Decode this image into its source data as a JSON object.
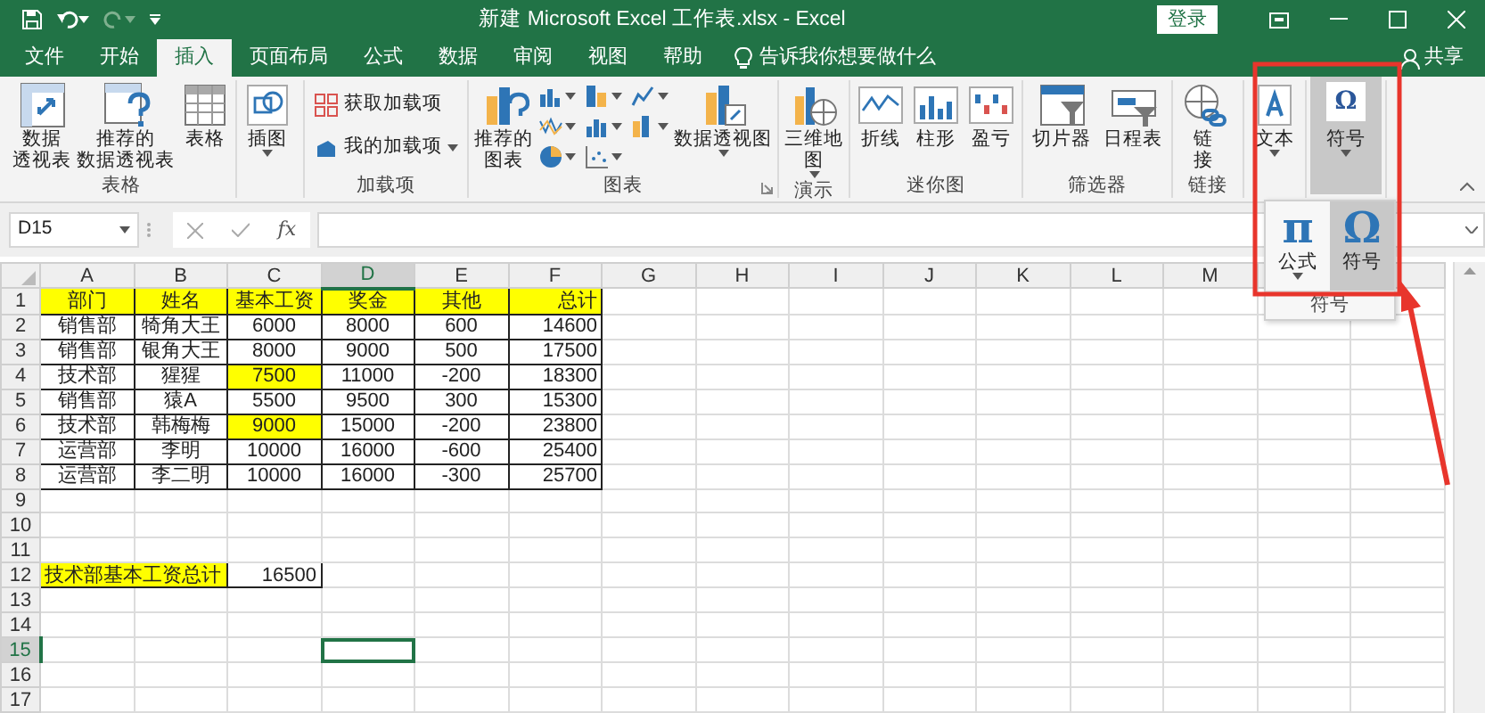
{
  "title_bar": {
    "title": "新建 Microsoft Excel 工作表.xlsx - Excel",
    "login": "登录"
  },
  "tabs": [
    {
      "label": "文件",
      "selected": false
    },
    {
      "label": "开始",
      "selected": false
    },
    {
      "label": "插入",
      "selected": true
    },
    {
      "label": "页面布局",
      "selected": false
    },
    {
      "label": "公式",
      "selected": false
    },
    {
      "label": "数据",
      "selected": false
    },
    {
      "label": "审阅",
      "selected": false
    },
    {
      "label": "视图",
      "selected": false
    },
    {
      "label": "帮助",
      "selected": false
    }
  ],
  "tell_me": "告诉我你想要做什么",
  "share": "共享",
  "ribbon": {
    "groups": [
      {
        "label": "表格",
        "buttons": [
          {
            "lines": [
              "数据",
              "透视表"
            ],
            "kind": "large",
            "dropdown": false
          },
          {
            "lines": [
              "推荐的",
              "数据透视表"
            ],
            "kind": "large",
            "dropdown": false
          },
          {
            "lines": [
              "表格"
            ],
            "kind": "large",
            "dropdown": false
          }
        ]
      },
      {
        "buttons": [
          {
            "lines": [
              "插图"
            ],
            "kind": "large",
            "dropdown": true
          }
        ]
      },
      {
        "label": "加载项",
        "buttons": [
          {
            "label": "获取加载项",
            "kind": "small",
            "dropdown": false
          },
          {
            "label": "我的加载项",
            "kind": "small",
            "dropdown": true
          }
        ]
      },
      {
        "label": "图表",
        "launcher": true,
        "buttons": [
          {
            "lines": [
              "推荐的",
              "图表"
            ],
            "kind": "large",
            "dropdown": false
          },
          {
            "kind": "chart_grid",
            "dropdown": true
          },
          {
            "lines": [
              "数据透视图"
            ],
            "kind": "large",
            "dropdown": true
          }
        ]
      },
      {
        "label": "演示",
        "buttons": [
          {
            "lines": [
              "三维地",
              "图"
            ],
            "kind": "large",
            "dropdown": true
          }
        ]
      },
      {
        "label": "迷你图",
        "buttons": [
          {
            "lines": [
              "折线"
            ],
            "kind": "large",
            "dropdown": false
          },
          {
            "lines": [
              "柱形"
            ],
            "kind": "large",
            "dropdown": false
          },
          {
            "lines": [
              "盈亏"
            ],
            "kind": "large",
            "dropdown": false
          }
        ]
      },
      {
        "label": "筛选器",
        "buttons": [
          {
            "lines": [
              "切片器"
            ],
            "kind": "large",
            "dropdown": false
          },
          {
            "lines": [
              "日程表"
            ],
            "kind": "large",
            "dropdown": false
          }
        ]
      },
      {
        "label": "链接",
        "buttons": [
          {
            "lines": [
              "链",
              "接"
            ],
            "kind": "large",
            "dropdown": false
          }
        ]
      },
      {
        "buttons": [
          {
            "lines": [
              "文本"
            ],
            "kind": "large",
            "dropdown": true
          }
        ]
      },
      {
        "buttons": [
          {
            "label": "符号",
            "kind": "glyph",
            "glyph": "Ω",
            "dropdown": true,
            "expanded": true
          }
        ]
      }
    ]
  },
  "symbols_popup": {
    "items": [
      {
        "glyph": "π",
        "label": "公式",
        "dropdown": true,
        "selected": false
      },
      {
        "glyph": "Ω",
        "label": "符号",
        "dropdown": false,
        "selected": true
      }
    ],
    "group_label": "符号"
  },
  "formula_bar": {
    "name_box": "D15",
    "function_label": "fx"
  },
  "sheet": {
    "columns": [
      {
        "label": "A",
        "selected": false
      },
      {
        "label": "B",
        "selected": false
      },
      {
        "label": "C",
        "selected": false
      },
      {
        "label": "D",
        "selected": true
      },
      {
        "label": "E",
        "selected": false
      },
      {
        "label": "F",
        "selected": false
      },
      {
        "label": "G",
        "selected": false
      },
      {
        "label": "H",
        "selected": false
      },
      {
        "label": "I",
        "selected": false
      },
      {
        "label": "J",
        "selected": false
      },
      {
        "label": "K",
        "selected": false
      },
      {
        "label": "L",
        "selected": false
      },
      {
        "label": "M",
        "selected": false
      },
      {
        "selected": false
      },
      {
        "selected": false
      }
    ],
    "rows": [
      {
        "label": "1",
        "selected": false,
        "cells": [
          {
            "text": "部门",
            "highlighted": true
          },
          {
            "text": "姓名",
            "highlighted": true
          },
          {
            "text": "基本工资",
            "highlighted": true
          },
          {
            "text": "奖金",
            "highlighted": true
          },
          {
            "text": "其他",
            "highlighted": true
          },
          {
            "text": "总计",
            "highlighted": true
          }
        ]
      },
      {
        "label": "2",
        "selected": false,
        "cells": [
          {
            "text": "销售部",
            "highlighted": false
          },
          {
            "text": "犄角大王",
            "highlighted": false
          },
          {
            "text": "6000",
            "highlighted": false
          },
          {
            "text": "8000",
            "highlighted": false
          },
          {
            "text": "600",
            "highlighted": false
          },
          {
            "text": "14600",
            "highlighted": false
          }
        ]
      },
      {
        "label": "3",
        "selected": false,
        "cells": [
          {
            "text": "销售部",
            "highlighted": false
          },
          {
            "text": "银角大王",
            "highlighted": false
          },
          {
            "text": "8000",
            "highlighted": false
          },
          {
            "text": "9000",
            "highlighted": false
          },
          {
            "text": "500",
            "highlighted": false
          },
          {
            "text": "17500",
            "highlighted": false
          }
        ]
      },
      {
        "label": "4",
        "selected": false,
        "cells": [
          {
            "text": "技术部",
            "highlighted": false
          },
          {
            "text": "猩猩",
            "highlighted": false
          },
          {
            "text": "7500",
            "highlighted": true
          },
          {
            "text": "11000",
            "highlighted": false
          },
          {
            "text": "-200",
            "highlighted": false
          },
          {
            "text": "18300",
            "highlighted": false
          }
        ]
      },
      {
        "label": "5",
        "selected": false,
        "cells": [
          {
            "text": "销售部",
            "highlighted": false
          },
          {
            "text": "猿A",
            "highlighted": false
          },
          {
            "text": "5500",
            "highlighted": false
          },
          {
            "text": "9500",
            "highlighted": false
          },
          {
            "text": "300",
            "highlighted": false
          },
          {
            "text": "15300",
            "highlighted": false
          }
        ]
      },
      {
        "label": "6",
        "selected": false,
        "cells": [
          {
            "text": "技术部",
            "highlighted": false
          },
          {
            "text": "韩梅梅",
            "highlighted": false
          },
          {
            "text": "9000",
            "highlighted": true
          },
          {
            "text": "15000",
            "highlighted": false
          },
          {
            "text": "-200",
            "highlighted": false
          },
          {
            "text": "23800",
            "highlighted": false
          }
        ]
      },
      {
        "label": "7",
        "selected": false,
        "cells": [
          {
            "text": "运营部",
            "highlighted": false
          },
          {
            "text": "李明",
            "highlighted": false
          },
          {
            "text": "10000",
            "highlighted": false
          },
          {
            "text": "16000",
            "highlighted": false
          },
          {
            "text": "-600",
            "highlighted": false
          },
          {
            "text": "25400",
            "highlighted": false
          }
        ]
      },
      {
        "label": "8",
        "selected": false,
        "cells": [
          {
            "text": "运营部",
            "highlighted": false
          },
          {
            "text": "李二明",
            "highlighted": false
          },
          {
            "text": "10000",
            "highlighted": false
          },
          {
            "text": "16000",
            "highlighted": false
          },
          {
            "text": "-300",
            "highlighted": false
          },
          {
            "text": "25700",
            "highlighted": false
          }
        ]
      },
      {
        "label": "9",
        "selected": false
      },
      {
        "label": "10",
        "selected": false
      },
      {
        "label": "11",
        "selected": false
      },
      {
        "label": "12",
        "selected": false,
        "cells": [
          {
            "text": "技术部基本工资总计",
            "highlighted": true,
            "merged": true
          },
          {
            "text": "16500",
            "highlighted": false
          }
        ]
      },
      {
        "label": "13",
        "selected": false
      },
      {
        "label": "14",
        "selected": false
      },
      {
        "label": "15",
        "selected": true
      },
      {
        "label": "16",
        "selected": false
      },
      {
        "label": "17",
        "selected": false
      }
    ]
  }
}
